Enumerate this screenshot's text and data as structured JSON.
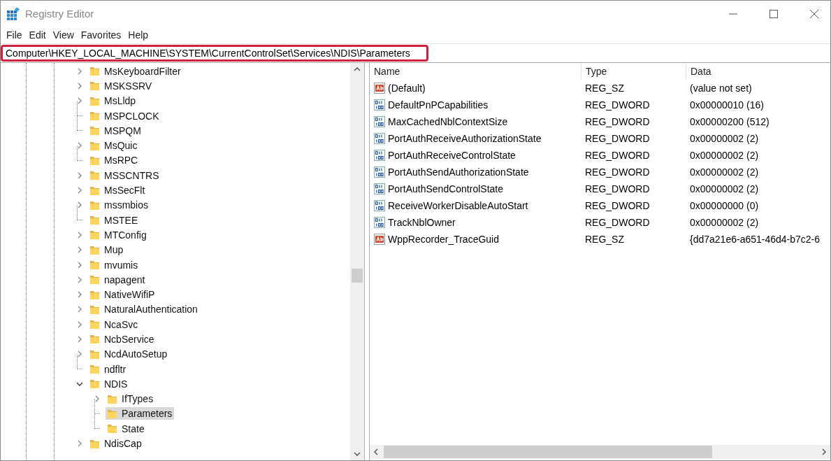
{
  "window": {
    "title": "Registry Editor"
  },
  "menu": [
    {
      "label": "File"
    },
    {
      "label": "Edit"
    },
    {
      "label": "View"
    },
    {
      "label": "Favorites"
    },
    {
      "label": "Help"
    }
  ],
  "address": {
    "value": "Computer\\HKEY_LOCAL_MACHINE\\SYSTEM\\CurrentControlSet\\Services\\NDIS\\Parameters"
  },
  "tree": [
    {
      "label": "MsKeyboardFilter",
      "kind": "branch",
      "expanded": false,
      "selected": false
    },
    {
      "label": "MSKSSRV",
      "kind": "branch",
      "expanded": false,
      "selected": false
    },
    {
      "label": "MsLldp",
      "kind": "branch",
      "expanded": false,
      "selected": false
    },
    {
      "label": "MSPCLOCK",
      "kind": "leaf",
      "selected": false
    },
    {
      "label": "MSPQM",
      "kind": "leaf",
      "selected": false
    },
    {
      "label": "MsQuic",
      "kind": "branch",
      "expanded": false,
      "selected": false
    },
    {
      "label": "MsRPC",
      "kind": "leaf",
      "selected": false
    },
    {
      "label": "MSSCNTRS",
      "kind": "branch",
      "expanded": false,
      "selected": false
    },
    {
      "label": "MsSecFlt",
      "kind": "branch",
      "expanded": false,
      "selected": false
    },
    {
      "label": "mssmbios",
      "kind": "branch",
      "expanded": false,
      "selected": false
    },
    {
      "label": "MSTEE",
      "kind": "leaf",
      "selected": false
    },
    {
      "label": "MTConfig",
      "kind": "branch",
      "expanded": false,
      "selected": false
    },
    {
      "label": "Mup",
      "kind": "branch",
      "expanded": false,
      "selected": false
    },
    {
      "label": "mvumis",
      "kind": "branch",
      "expanded": false,
      "selected": false
    },
    {
      "label": "napagent",
      "kind": "branch",
      "expanded": false,
      "selected": false
    },
    {
      "label": "NativeWifiP",
      "kind": "branch",
      "expanded": false,
      "selected": false
    },
    {
      "label": "NaturalAuthentication",
      "kind": "branch",
      "expanded": false,
      "selected": false
    },
    {
      "label": "NcaSvc",
      "kind": "branch",
      "expanded": false,
      "selected": false
    },
    {
      "label": "NcbService",
      "kind": "branch",
      "expanded": false,
      "selected": false
    },
    {
      "label": "NcdAutoSetup",
      "kind": "branch",
      "expanded": false,
      "selected": false
    },
    {
      "label": "ndfltr",
      "kind": "leaf",
      "selected": false
    },
    {
      "label": "NDIS",
      "kind": "branch",
      "expanded": true,
      "selected": false,
      "children": [
        {
          "label": "IfTypes",
          "kind": "branch",
          "expanded": false,
          "selected": false
        },
        {
          "label": "Parameters",
          "kind": "leaf",
          "selected": true
        },
        {
          "label": "State",
          "kind": "leaf",
          "selected": false
        }
      ]
    },
    {
      "label": "NdisCap",
      "kind": "branch",
      "expanded": false,
      "selected": false
    }
  ],
  "values": {
    "columns": [
      "Name",
      "Type",
      "Data"
    ],
    "rows": [
      {
        "kind": "string",
        "name": "(Default)",
        "type": "REG_SZ",
        "data": "(value not set)"
      },
      {
        "kind": "binary",
        "name": "DefaultPnPCapabilities",
        "type": "REG_DWORD",
        "data": "0x00000010 (16)"
      },
      {
        "kind": "binary",
        "name": "MaxCachedNblContextSize",
        "type": "REG_DWORD",
        "data": "0x00000200 (512)"
      },
      {
        "kind": "binary",
        "name": "PortAuthReceiveAuthorizationState",
        "type": "REG_DWORD",
        "data": "0x00000002 (2)"
      },
      {
        "kind": "binary",
        "name": "PortAuthReceiveControlState",
        "type": "REG_DWORD",
        "data": "0x00000002 (2)"
      },
      {
        "kind": "binary",
        "name": "PortAuthSendAuthorizationState",
        "type": "REG_DWORD",
        "data": "0x00000002 (2)"
      },
      {
        "kind": "binary",
        "name": "PortAuthSendControlState",
        "type": "REG_DWORD",
        "data": "0x00000002 (2)"
      },
      {
        "kind": "binary",
        "name": "ReceiveWorkerDisableAutoStart",
        "type": "REG_DWORD",
        "data": "0x00000000 (0)"
      },
      {
        "kind": "binary",
        "name": "TrackNblOwner",
        "type": "REG_DWORD",
        "data": "0x00000002 (2)"
      },
      {
        "kind": "string",
        "name": "WppRecorder_TraceGuid",
        "type": "REG_SZ",
        "data": "{dd7a21e6-a651-46d4-b7c2-6"
      }
    ]
  }
}
